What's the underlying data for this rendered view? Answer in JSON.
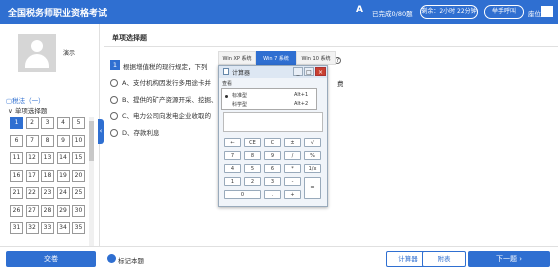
{
  "header": {
    "title": "全国税务师职业资格考试",
    "font_icon": "A",
    "answered": "已完成0/80题",
    "timer": "剩余：2小时 22分钟",
    "hand_raise": "举手呼叫",
    "seat_label": "座位号",
    "seat_number": "1"
  },
  "sidebar": {
    "demo_label": "演示",
    "section_title": "税法（一）",
    "subsection_title": "单项选择题",
    "questions": [
      "1",
      "2",
      "3",
      "4",
      "5",
      "6",
      "7",
      "8",
      "9",
      "10",
      "11",
      "12",
      "13",
      "14",
      "15",
      "16",
      "17",
      "18",
      "19",
      "20",
      "21",
      "22",
      "23",
      "24",
      "25",
      "26",
      "27",
      "28",
      "29",
      "30",
      "31",
      "32",
      "33",
      "34",
      "35"
    ],
    "current": "1",
    "legend": [
      {
        "label": "当前",
        "color": "#2f6fd1"
      },
      {
        "label": "未答",
        "color": "#ffffff"
      },
      {
        "label": "已完成",
        "color": "#4cb050"
      },
      {
        "label": "标记",
        "color": "#e53935"
      }
    ]
  },
  "question": {
    "type_title": "单项选择题",
    "number": "1",
    "text": "根据增值税的现行规定，下列",
    "text_tail": "费",
    "options": [
      {
        "letter": "A",
        "text": "A、支付机构因发行多用途卡并"
      },
      {
        "letter": "B",
        "text": "B、提供的矿产资源开采、挖掘、"
      },
      {
        "letter": "C",
        "text": "C、电力公司向发电企业收取的"
      },
      {
        "letter": "D",
        "text": "D、存款利息"
      }
    ]
  },
  "calculator": {
    "tabs": [
      "Win XP 系统",
      "Win 7 系统",
      "Win 10 系统"
    ],
    "active_tab": "Win 7 系统",
    "title": "计算器",
    "menu": "查看",
    "window_buttons": [
      "_",
      "□",
      "×"
    ],
    "modes": [
      {
        "label": "标准型",
        "shortcut": "Alt+1",
        "selected": true
      },
      {
        "label": "科学型",
        "shortcut": "Alt+2",
        "selected": false
      }
    ],
    "buttons": [
      [
        "←",
        "CE",
        "C",
        "±",
        "√"
      ],
      [
        "7",
        "8",
        "9",
        "/",
        "%"
      ],
      [
        "4",
        "5",
        "6",
        "*",
        "1/x"
      ],
      [
        "1",
        "2",
        "3",
        "-",
        "="
      ],
      [
        "0",
        ".",
        "+"
      ]
    ]
  },
  "footer": {
    "submit": "交卷",
    "mark": "标记本题",
    "calculator": "计算器",
    "appendix": "附表",
    "next": "下一题"
  }
}
